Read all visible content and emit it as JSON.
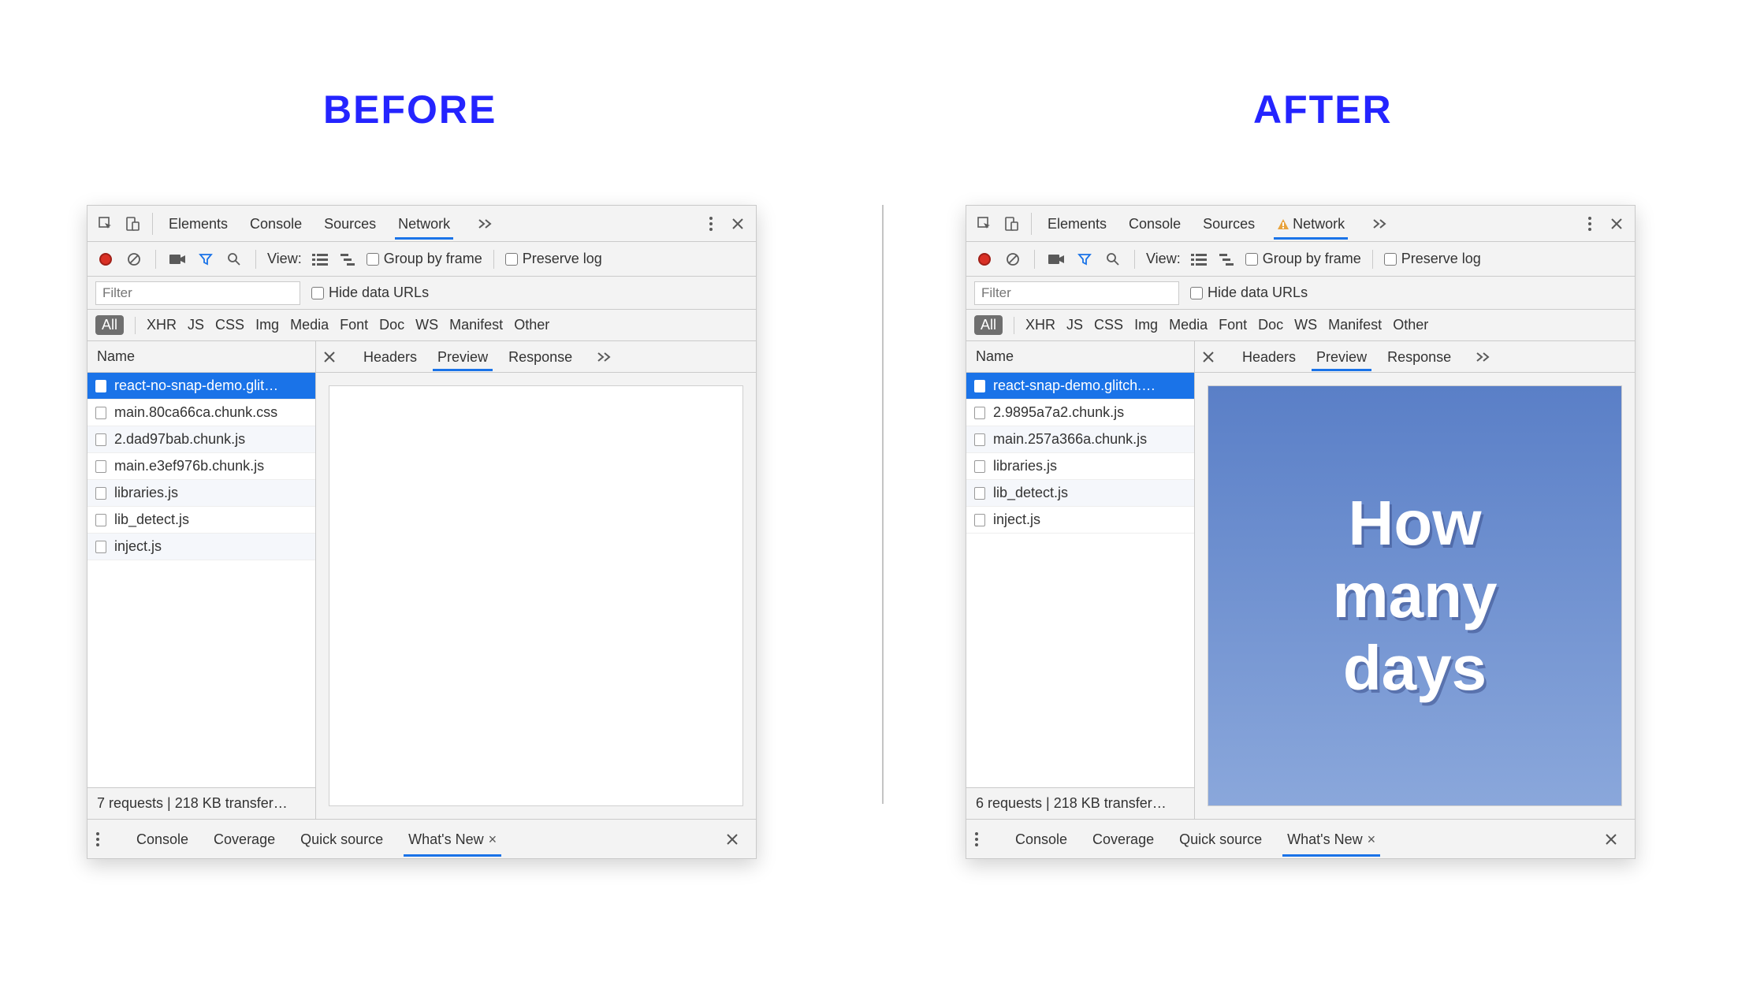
{
  "headings": {
    "before": "BEFORE",
    "after": "AFTER"
  },
  "tabs": {
    "elements": "Elements",
    "console": "Console",
    "sources": "Sources",
    "network": "Network"
  },
  "toolbar": {
    "view_label": "View:",
    "group_by_frame": "Group by frame",
    "preserve_log": "Preserve log"
  },
  "filter": {
    "placeholder": "Filter",
    "hide_data_urls": "Hide data URLs"
  },
  "chips": {
    "all": "All",
    "xhr": "XHR",
    "js": "JS",
    "css": "CSS",
    "img": "Img",
    "media": "Media",
    "font": "Font",
    "doc": "Doc",
    "ws": "WS",
    "manifest": "Manifest",
    "other": "Other"
  },
  "columns": {
    "name": "Name"
  },
  "detail_tabs": {
    "headers": "Headers",
    "preview": "Preview",
    "response": "Response"
  },
  "drawer_tabs": {
    "console": "Console",
    "coverage": "Coverage",
    "quick_source": "Quick source",
    "whats_new": "What's New"
  },
  "before": {
    "files": [
      "react-no-snap-demo.glit…",
      "main.80ca66ca.chunk.css",
      "2.dad97bab.chunk.js",
      "main.e3ef976b.chunk.js",
      "libraries.js",
      "lib_detect.js",
      "inject.js"
    ],
    "status": "7 requests | 218 KB transfer…"
  },
  "after": {
    "files": [
      "react-snap-demo.glitch.…",
      "2.9895a7a2.chunk.js",
      "main.257a366a.chunk.js",
      "libraries.js",
      "lib_detect.js",
      "inject.js"
    ],
    "status": "6 requests | 218 KB transfer…",
    "preview_text": "How\nmany\ndays"
  }
}
